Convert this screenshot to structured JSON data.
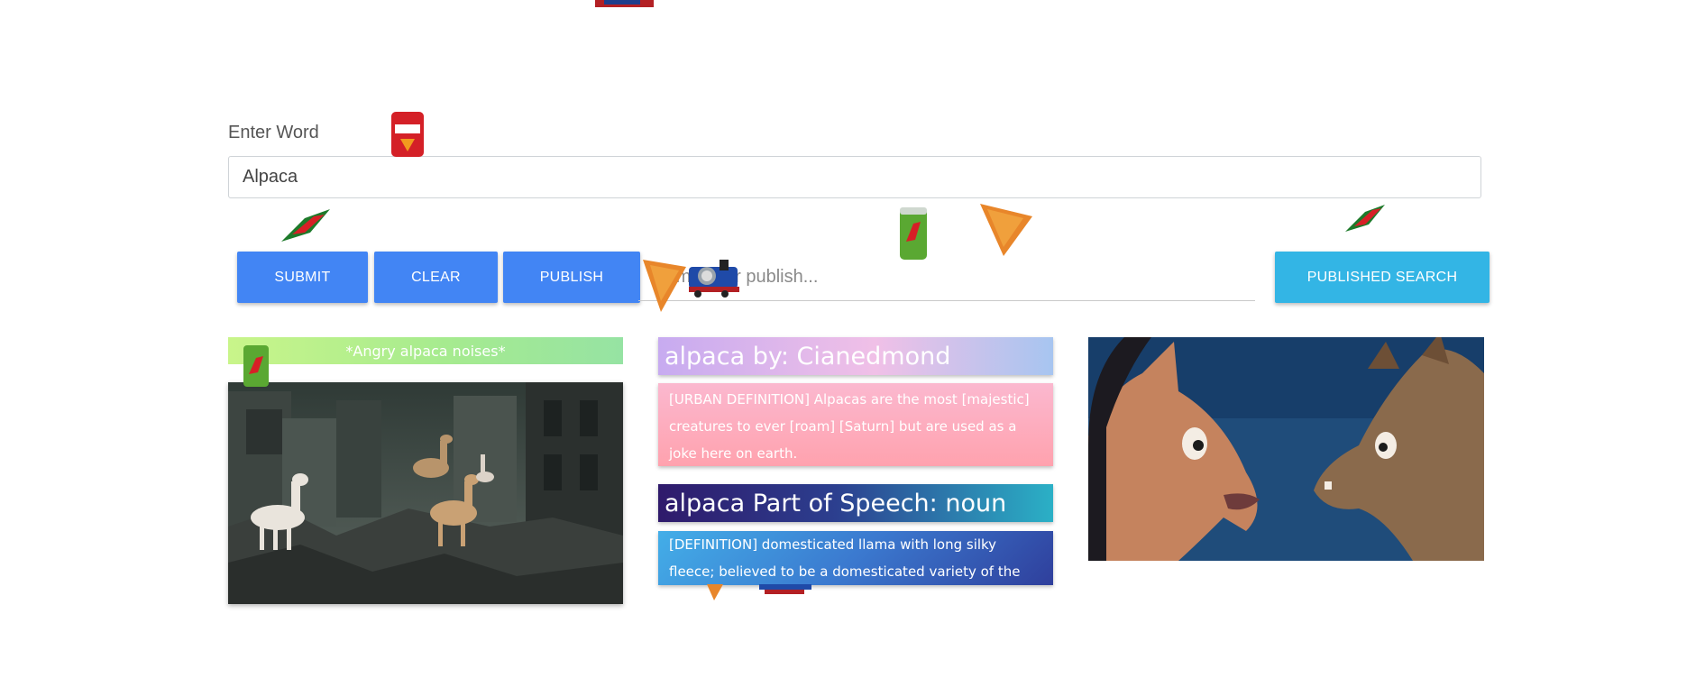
{
  "form": {
    "word_label": "Enter Word",
    "word_value": "Alpaca",
    "submit_label": "SUBMIT",
    "clear_label": "CLEAR",
    "publish_label": "PUBLISH",
    "publish_placeholder": "Name your publish...",
    "published_search_label": "PUBLISHED SEARCH"
  },
  "left": {
    "noises_text": "*Angry alpaca noises*"
  },
  "middle": {
    "urban_title": "alpaca by: Cianedmond",
    "urban_body": "[URBAN DEFINITION] Alpacas are the most [majestic] creatures to ever [roam] [Saturn] but are used as a joke here on earth.",
    "pos_title": "alpaca Part of Speech: noun",
    "pos_body": "[DEFINITION] domesticated llama with long silky fleece; believed to be a domesticated variety of the guanaco"
  },
  "colors": {
    "button_blue": "#4285f4",
    "button_cyan": "#33b5e5"
  },
  "decorations": [
    "doritos-bag-icon",
    "doritos-chip-icon",
    "mountain-dew-logo-icon",
    "mountain-dew-can-icon",
    "train-engine-icon"
  ]
}
